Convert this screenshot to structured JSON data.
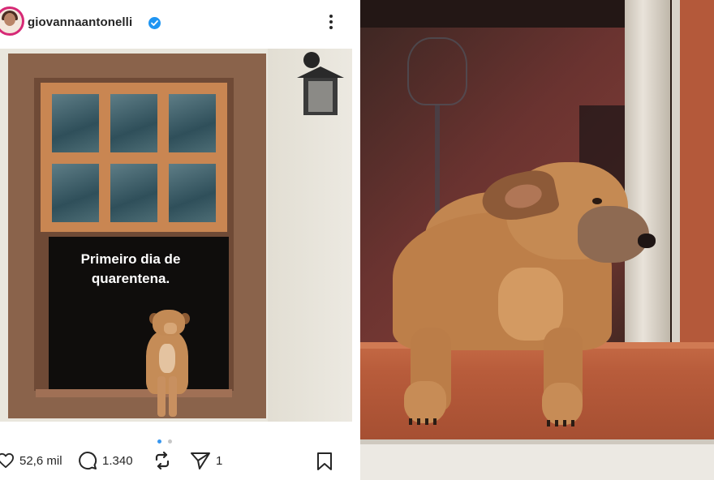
{
  "post": {
    "username": "giovannaantonelli",
    "image_caption": [
      "Primeiro dia de",
      "quarentena."
    ],
    "likes": "52,6 mil",
    "comments": "1.340",
    "shares": "1",
    "carousel": {
      "count": 2,
      "active": 0
    }
  },
  "icons": {
    "verified": "verified-badge-icon",
    "more": "more-options-icon",
    "like": "heart-icon",
    "comment": "comment-icon",
    "repost": "repost-icon",
    "share": "send-icon",
    "save": "bookmark-icon"
  },
  "colors": {
    "verified_blue": "#1f95f2",
    "text": "#262626",
    "carousel_active": "#3897f0",
    "carousel_inactive": "#c7c7c7"
  }
}
